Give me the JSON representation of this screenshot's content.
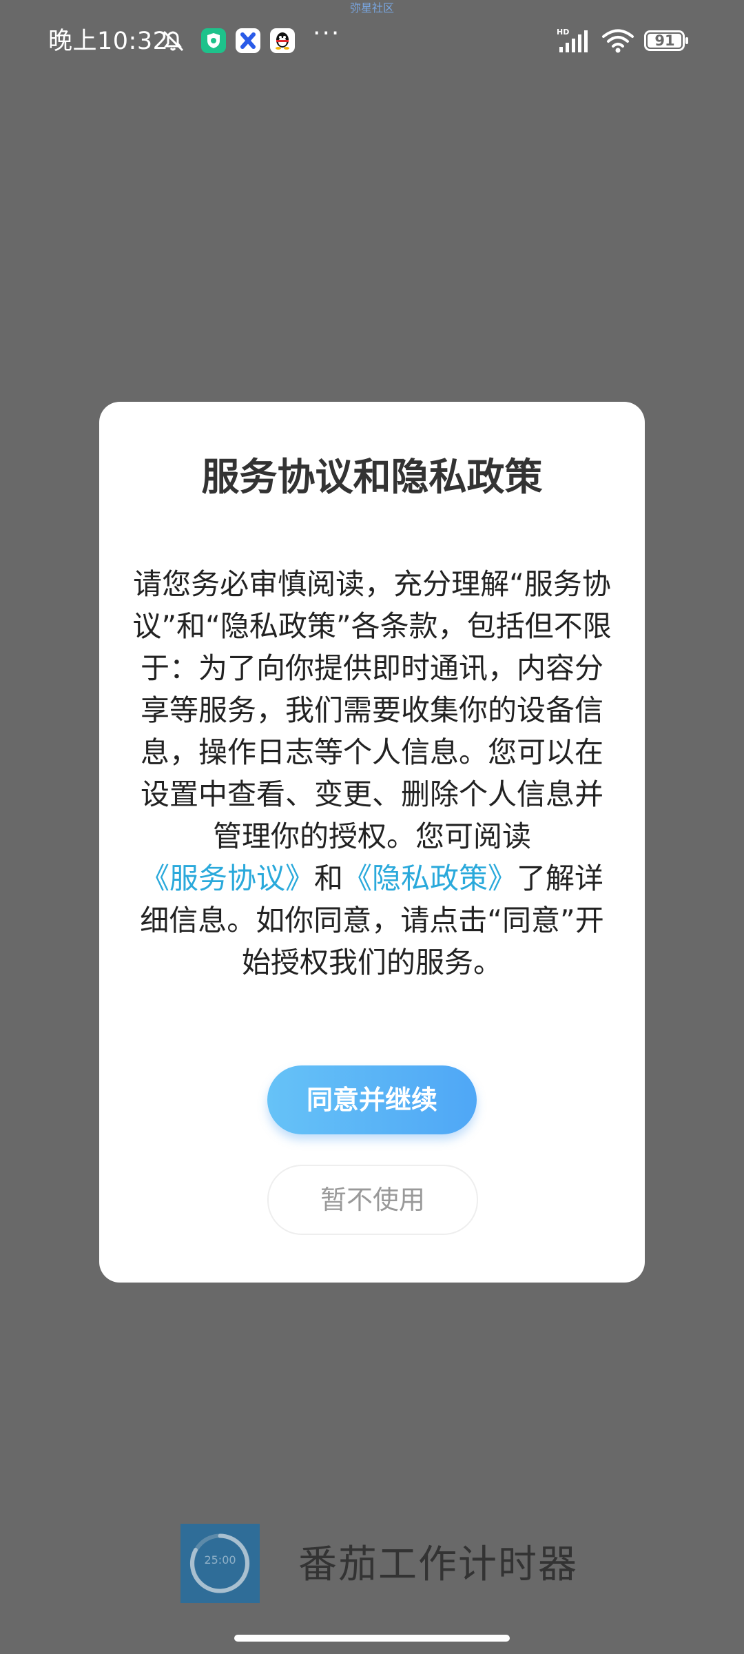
{
  "status_bar": {
    "watermark": "弥星社区",
    "time": "晚上10:32",
    "more": "···",
    "battery_level": "91",
    "network_badge": "HD"
  },
  "dialog": {
    "title": "服务协议和隐私政策",
    "body_part1": "请您务必审慎阅读，充分理解“服务协议”和“隐私政策”各条款，包括但不限于：为了向你提供即时通讯，内容分享等服务，我们需要收集你的设备信息，操作日志等个人信息。您可以在设置中查看、变更、删除个人信息并管理你的授权。您可阅读",
    "link_service": "《服务协议》",
    "body_and": "和",
    "link_privacy": "《隐私政策》",
    "body_part2": "了解详细信息。如你同意，请点击“同意”开始授权我们的服务。",
    "agree_label": "同意并继续",
    "decline_label": "暂不使用"
  },
  "splash": {
    "timer_text": "25:00",
    "app_name": "番茄工作计时器"
  },
  "colors": {
    "overlay": "#696969",
    "link": "#2aa9db",
    "agree_gradient_start": "#66c2f7",
    "agree_gradient_end": "#4fa7f6"
  }
}
